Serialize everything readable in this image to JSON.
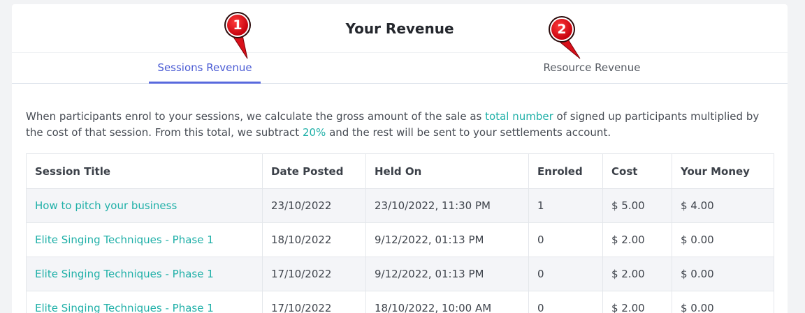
{
  "page": {
    "title": "Your Revenue"
  },
  "tabs": [
    {
      "label": "Sessions Revenue",
      "active": true
    },
    {
      "label": "Resource Revenue",
      "active": false
    }
  ],
  "description": {
    "part1": "When participants enrol to your sessions, we calculate the gross amount of the sale as ",
    "highlight1": "total number",
    "part2": " of signed up participants multiplied by the cost of that session. From this total, we subtract ",
    "highlight2": "20%",
    "part3": " and the rest will be sent to your settlements account."
  },
  "table": {
    "headers": [
      "Session Title",
      "Date Posted",
      "Held On",
      "Enroled",
      "Cost",
      "Your Money"
    ],
    "rows": [
      {
        "title": "How to pitch your business",
        "date_posted": "23/10/2022",
        "held_on": "23/10/2022, 11:30 PM",
        "enroled": "1",
        "cost": "$ 5.00",
        "your_money": "$ 4.00"
      },
      {
        "title": "Elite Singing Techniques - Phase 1",
        "date_posted": "18/10/2022",
        "held_on": "9/12/2022, 01:13 PM",
        "enroled": "0",
        "cost": "$ 2.00",
        "your_money": "$ 0.00"
      },
      {
        "title": "Elite Singing Techniques - Phase 1",
        "date_posted": "17/10/2022",
        "held_on": "9/12/2022, 01:13 PM",
        "enroled": "0",
        "cost": "$ 2.00",
        "your_money": "$ 0.00"
      },
      {
        "title": "Elite Singing Techniques - Phase 1",
        "date_posted": "17/10/2022",
        "held_on": "18/10/2022, 10:00 AM",
        "enroled": "0",
        "cost": "$ 2.00",
        "your_money": "$ 0.00"
      }
    ]
  },
  "annotations": [
    {
      "label": "1",
      "icon": "numbered-marker-icon"
    },
    {
      "label": "2",
      "icon": "numbered-marker-icon"
    }
  ],
  "colors": {
    "accent": "#5869dd",
    "link": "#20b0a8",
    "marker": "#e3101c"
  }
}
